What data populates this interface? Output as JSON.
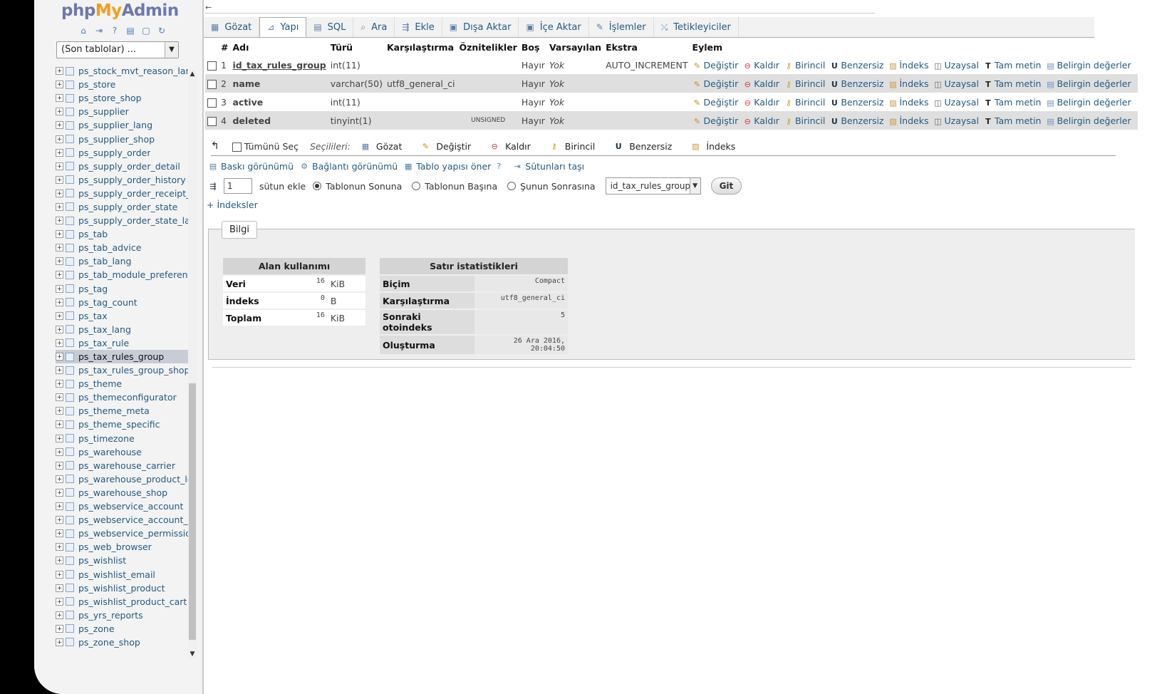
{
  "app": {
    "logo_php": "php",
    "logo_my": "My",
    "logo_admin": "Admin"
  },
  "nav": {
    "recent_tables": "(Son tablolar) ...",
    "tables": [
      "ps_stock_mvt_reason_lan",
      "ps_store",
      "ps_store_shop",
      "ps_supplier",
      "ps_supplier_lang",
      "ps_supplier_shop",
      "ps_supply_order",
      "ps_supply_order_detail",
      "ps_supply_order_history",
      "ps_supply_order_receipt_l",
      "ps_supply_order_state",
      "ps_supply_order_state_lar",
      "ps_tab",
      "ps_tab_advice",
      "ps_tab_lang",
      "ps_tab_module_preferenc",
      "ps_tag",
      "ps_tag_count",
      "ps_tax",
      "ps_tax_lang",
      "ps_tax_rule",
      "ps_tax_rules_group",
      "ps_tax_rules_group_shop",
      "ps_theme",
      "ps_themeconfigurator",
      "ps_theme_meta",
      "ps_theme_specific",
      "ps_timezone",
      "ps_warehouse",
      "ps_warehouse_carrier",
      "ps_warehouse_product_lo",
      "ps_warehouse_shop",
      "ps_webservice_account",
      "ps_webservice_account_s",
      "ps_webservice_permissior",
      "ps_web_browser",
      "ps_wishlist",
      "ps_wishlist_email",
      "ps_wishlist_product",
      "ps_wishlist_product_cart",
      "ps_yrs_reports",
      "ps_zone",
      "ps_zone_shop"
    ],
    "selected_index": 21
  },
  "tabs": [
    {
      "label": "Gözat",
      "icon": "table-icon"
    },
    {
      "label": "Yapı",
      "icon": "structure-icon",
      "active": true
    },
    {
      "label": "SQL",
      "icon": "sql-icon"
    },
    {
      "label": "Ara",
      "icon": "search-icon"
    },
    {
      "label": "Ekle",
      "icon": "insert-icon"
    },
    {
      "label": "Dışa Aktar",
      "icon": "export-icon"
    },
    {
      "label": "İçe Aktar",
      "icon": "import-icon"
    },
    {
      "label": "İşlemler",
      "icon": "wrench-icon"
    },
    {
      "label": "Tetikleyiciler",
      "icon": "triggers-icon"
    }
  ],
  "structure": {
    "headers": [
      "#",
      "Adı",
      "Türü",
      "Karşılaştırma",
      "Öznitelikler",
      "Boş",
      "Varsayılan",
      "Ekstra",
      "Eylem"
    ],
    "rows": [
      {
        "num": "1",
        "name": "id_tax_rules_group",
        "type": "int(11)",
        "collation": "",
        "attributes": "",
        "null": "Hayır",
        "default": "Yok",
        "extra": "AUTO_INCREMENT"
      },
      {
        "num": "2",
        "name": "name",
        "type": "varchar(50)",
        "collation": "utf8_general_ci",
        "attributes": "",
        "null": "Hayır",
        "default": "Yok",
        "extra": ""
      },
      {
        "num": "3",
        "name": "active",
        "type": "int(11)",
        "collation": "",
        "attributes": "",
        "null": "Hayır",
        "default": "Yok",
        "extra": ""
      },
      {
        "num": "4",
        "name": "deleted",
        "type": "tinyint(1)",
        "collation": "",
        "attributes": "UNSIGNED",
        "null": "Hayır",
        "default": "Yok",
        "extra": ""
      }
    ],
    "actions": [
      "Değiştir",
      "Kaldır",
      "Birincil",
      "Benzersiz",
      "İndeks",
      "Uzaysal",
      "Tam metin",
      "Belirgin değerler"
    ]
  },
  "with_selected": {
    "check_all": "Tümünü Seç",
    "label": "Seçilileri:",
    "buttons": [
      "Gözat",
      "Değiştir",
      "Kaldır",
      "Birincil",
      "Benzersiz",
      "İndeks"
    ]
  },
  "links": [
    "Baskı görünümü",
    "Bağlantı görünümü",
    "Tablo yapısı öner",
    "Sütunları taşı"
  ],
  "add_column": {
    "count": "1",
    "label": "sütun ekle",
    "options": [
      "Tablonun Sonuna",
      "Tablonun Başına",
      "Şunun Sonrasına"
    ],
    "after_field": "id_tax_rules_group",
    "go": "Git"
  },
  "indexes_link": "+ İndeksler",
  "info": {
    "legend": "Bilgi",
    "space": {
      "title": "Alan kullanımı",
      "rows": [
        {
          "name": "Veri",
          "value": "16",
          "unit": "KiB"
        },
        {
          "name": "İndeks",
          "value": "0",
          "unit": "B"
        },
        {
          "name": "Toplam",
          "value": "16",
          "unit": "KiB"
        }
      ]
    },
    "rowstats": {
      "title": "Satır istatistikleri",
      "rows": [
        {
          "name": "Biçim",
          "value": "Compact"
        },
        {
          "name": "Karşılaştırma",
          "value": "utf8_general_ci"
        },
        {
          "name": "Sonraki otoindeks",
          "value": "5"
        },
        {
          "name": "Oluşturma",
          "value": "26 Ara 2016, 20:04:50"
        }
      ]
    }
  }
}
